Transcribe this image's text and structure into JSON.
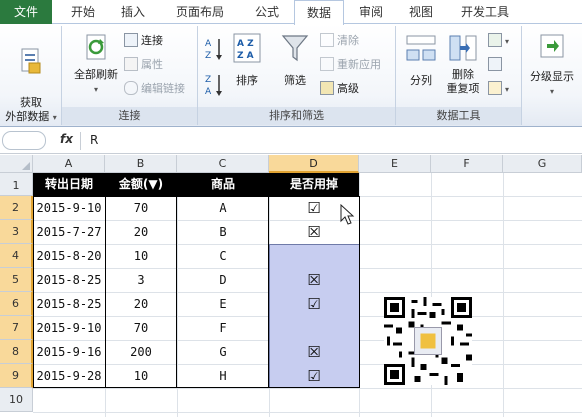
{
  "tabs": [
    "文件",
    "开始",
    "插入",
    "页面布局",
    "公式",
    "数据",
    "审阅",
    "视图",
    "开发工具"
  ],
  "ribbon": {
    "get_external": "获取\n外部数据",
    "refresh_all": "全部刷新",
    "connections": "连接",
    "properties": "属性",
    "edit_links": "编辑链接",
    "group_connections": "连接",
    "sort": "排序",
    "filter": "筛选",
    "clear": "清除",
    "reapply": "重新应用",
    "advanced": "高级",
    "group_sort_filter": "排序和筛选",
    "text_to_columns": "分列",
    "remove_dup_1": "删除",
    "remove_dup_2": "重复项",
    "group_data_tools": "数据工具",
    "outline": "分级显示"
  },
  "formula_bar": {
    "fx": "fx",
    "value": "R"
  },
  "columns": [
    "A",
    "B",
    "C",
    "D",
    "E",
    "F",
    "G"
  ],
  "rows": [
    "1",
    "2",
    "3",
    "4",
    "5",
    "6",
    "7",
    "8",
    "9",
    "10"
  ],
  "table": {
    "headers": [
      "转出日期",
      "金额(▼)",
      "商品",
      "是否用掉"
    ],
    "rows": [
      [
        "2015-9-10",
        "70",
        "A",
        "☑"
      ],
      [
        "2015-7-27",
        "20",
        "B",
        "☒"
      ],
      [
        "2015-8-20",
        "10",
        "C",
        ""
      ],
      [
        "2015-8-25",
        "3",
        "D",
        "☒"
      ],
      [
        "2015-8-25",
        "20",
        "E",
        "☑"
      ],
      [
        "2015-9-10",
        "70",
        "F",
        ""
      ],
      [
        "2015-9-16",
        "200",
        "G",
        "☒"
      ],
      [
        "2015-9-28",
        "10",
        "H",
        "☑"
      ]
    ]
  },
  "colors": {
    "file_tab": "#2b7a3e",
    "selection": "#c7cdf0",
    "header_selected": "#f9d99a"
  }
}
